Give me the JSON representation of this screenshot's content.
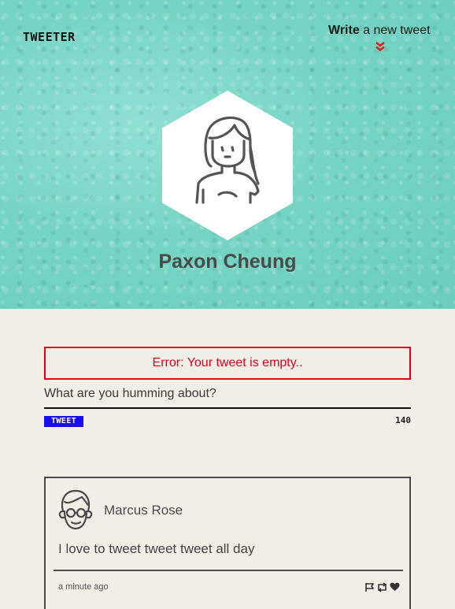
{
  "header": {
    "logo": "TWEETER",
    "write_bold": "Write",
    "write_rest": " a new tweet"
  },
  "profile": {
    "name": "Paxon Cheung"
  },
  "compose": {
    "error": "Error: Your tweet is empty..",
    "placeholder": "What are you humming about?",
    "button_label": "TWEET",
    "counter": "140"
  },
  "tweets": [
    {
      "user": "Marcus Rose",
      "text": "I love to tweet tweet tweet all day",
      "time": "a minute ago",
      "actions": [
        "flag-icon",
        "retweet-icon",
        "heart-icon"
      ]
    }
  ],
  "colors": {
    "hero": "#7fd8c8",
    "background": "#f1eee8",
    "error": "#e0001a",
    "button": "#1a0cf0",
    "chevron": "#d9221b"
  }
}
